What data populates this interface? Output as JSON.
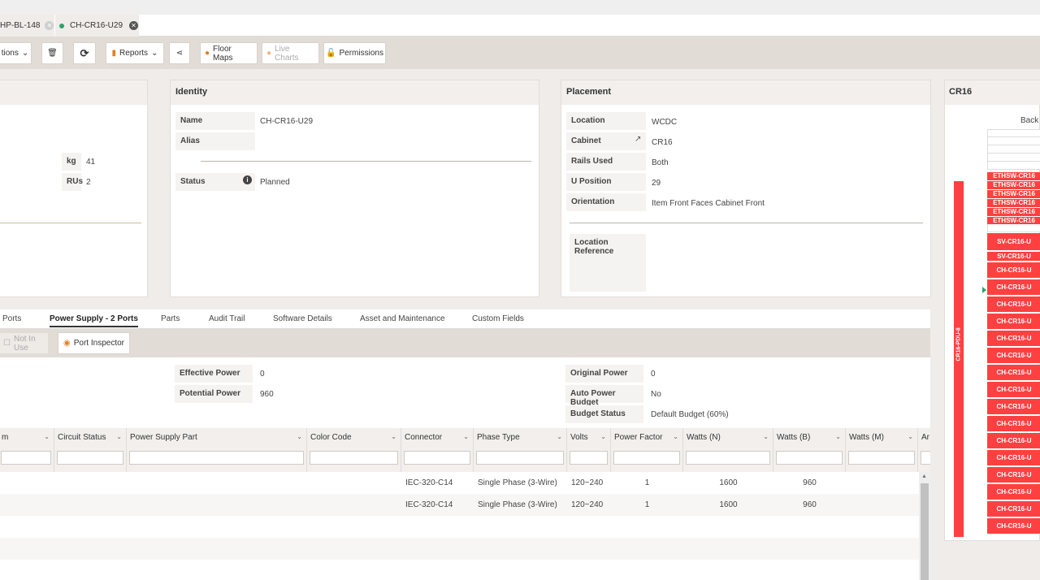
{
  "tabs": [
    {
      "label": "HP-BL-148"
    },
    {
      "label": "CH-CR16-U29"
    }
  ],
  "toolbar": {
    "operations": "tions",
    "reports": "Reports",
    "floor_maps": "Floor Maps",
    "live_charts": "Live Charts",
    "permissions": "Permissions"
  },
  "left_panel": {
    "kg_label": "kg",
    "kg_value": "41",
    "rus_label": "RUs",
    "rus_value": "2"
  },
  "identity": {
    "title": "Identity",
    "name_label": "Name",
    "name_value": "CH-CR16-U29",
    "alias_label": "Alias",
    "alias_value": "",
    "status_label": "Status",
    "status_value": "Planned"
  },
  "placement": {
    "title": "Placement",
    "location_label": "Location",
    "location_value": "WCDC",
    "cabinet_label": "Cabinet",
    "cabinet_value": "CR16",
    "rails_label": "Rails Used",
    "rails_value": "Both",
    "upos_label": "U Position",
    "upos_value": "29",
    "orient_label": "Orientation",
    "orient_value": "Item Front Faces Cabinet Front",
    "locref_label": "Location Reference"
  },
  "rack": {
    "title": "CR16",
    "back_label": "Back",
    "pdu_label": "CR16-PDU-8",
    "slots": [
      "ETHSW-CR16",
      "ETHSW-CR16",
      "ETHSW-CR16",
      "ETHSW-CR16",
      "ETHSW-CR16",
      "ETHSW-CR16",
      "SV-CR16-U",
      "SV-CR16-U",
      "CH-CR16-U",
      "CH-CR16-U",
      "CH-CR16-U",
      "CH-CR16-U",
      "CH-CR16-U",
      "CH-CR16-U",
      "CH-CR16-U",
      "CH-CR16-U",
      "CH-CR16-U",
      "CH-CR16-U",
      "CH-CR16-U",
      "CH-CR16-U",
      "CH-CR16-U",
      "CH-CR16-U",
      "CH-CR16-U",
      "CH-CR16-U"
    ]
  },
  "detail_tabs": [
    "Ports",
    "Power Supply - 2 Ports",
    "Parts",
    "Audit Trail",
    "Software Details",
    "Asset and Maintenance",
    "Custom Fields"
  ],
  "subtool": {
    "not_in_use": "Not In Use",
    "port_inspector": "Port Inspector"
  },
  "power": {
    "effective_label": "Effective Power",
    "effective_value": "0",
    "potential_label": "Potential Power",
    "potential_value": "960",
    "original_label": "Original Power",
    "original_value": "0",
    "auto_label": "Auto Power Budget",
    "auto_value": "No",
    "budget_label": "Budget Status",
    "budget_value": "Default Budget (60%)"
  },
  "grid": {
    "columns": [
      "m",
      "Circuit Status",
      "Power Supply Part",
      "Color Code",
      "Connector",
      "Phase Type",
      "Volts",
      "Power Factor",
      "Watts (N)",
      "Watts (B)",
      "Watts (M)",
      "Ar"
    ],
    "rows": [
      [
        "",
        "",
        "",
        "",
        "IEC-320-C14",
        "Single Phase (3-Wire)",
        "120~240",
        "1",
        "1600",
        "960",
        "",
        ""
      ],
      [
        "",
        "",
        "",
        "",
        "IEC-320-C14",
        "Single Phase (3-Wire)",
        "120~240",
        "1",
        "1600",
        "960",
        "",
        ""
      ]
    ]
  }
}
